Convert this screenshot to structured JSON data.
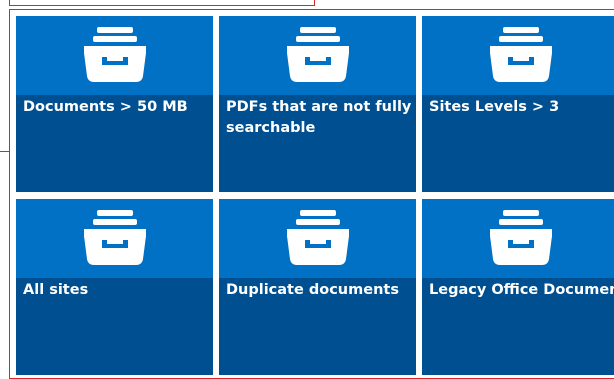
{
  "tiles": [
    {
      "label": "Documents > 50 MB",
      "icon": "archive-drawer-icon"
    },
    {
      "label": "PDFs that are not fully searchable",
      "icon": "archive-drawer-icon"
    },
    {
      "label": "Sites Levels > 3",
      "icon": "archive-drawer-icon"
    },
    {
      "label": "All sites",
      "icon": "archive-drawer-icon"
    },
    {
      "label": "Duplicate documents",
      "icon": "archive-drawer-icon"
    },
    {
      "label": "Legacy Office Documents",
      "icon": "archive-drawer-icon"
    }
  ],
  "colors": {
    "tile_top": "#0071c5",
    "tile_bottom": "#005091",
    "label_text": "#ffffff",
    "selection_outline": "#d9262e",
    "background": "#ffffff"
  }
}
